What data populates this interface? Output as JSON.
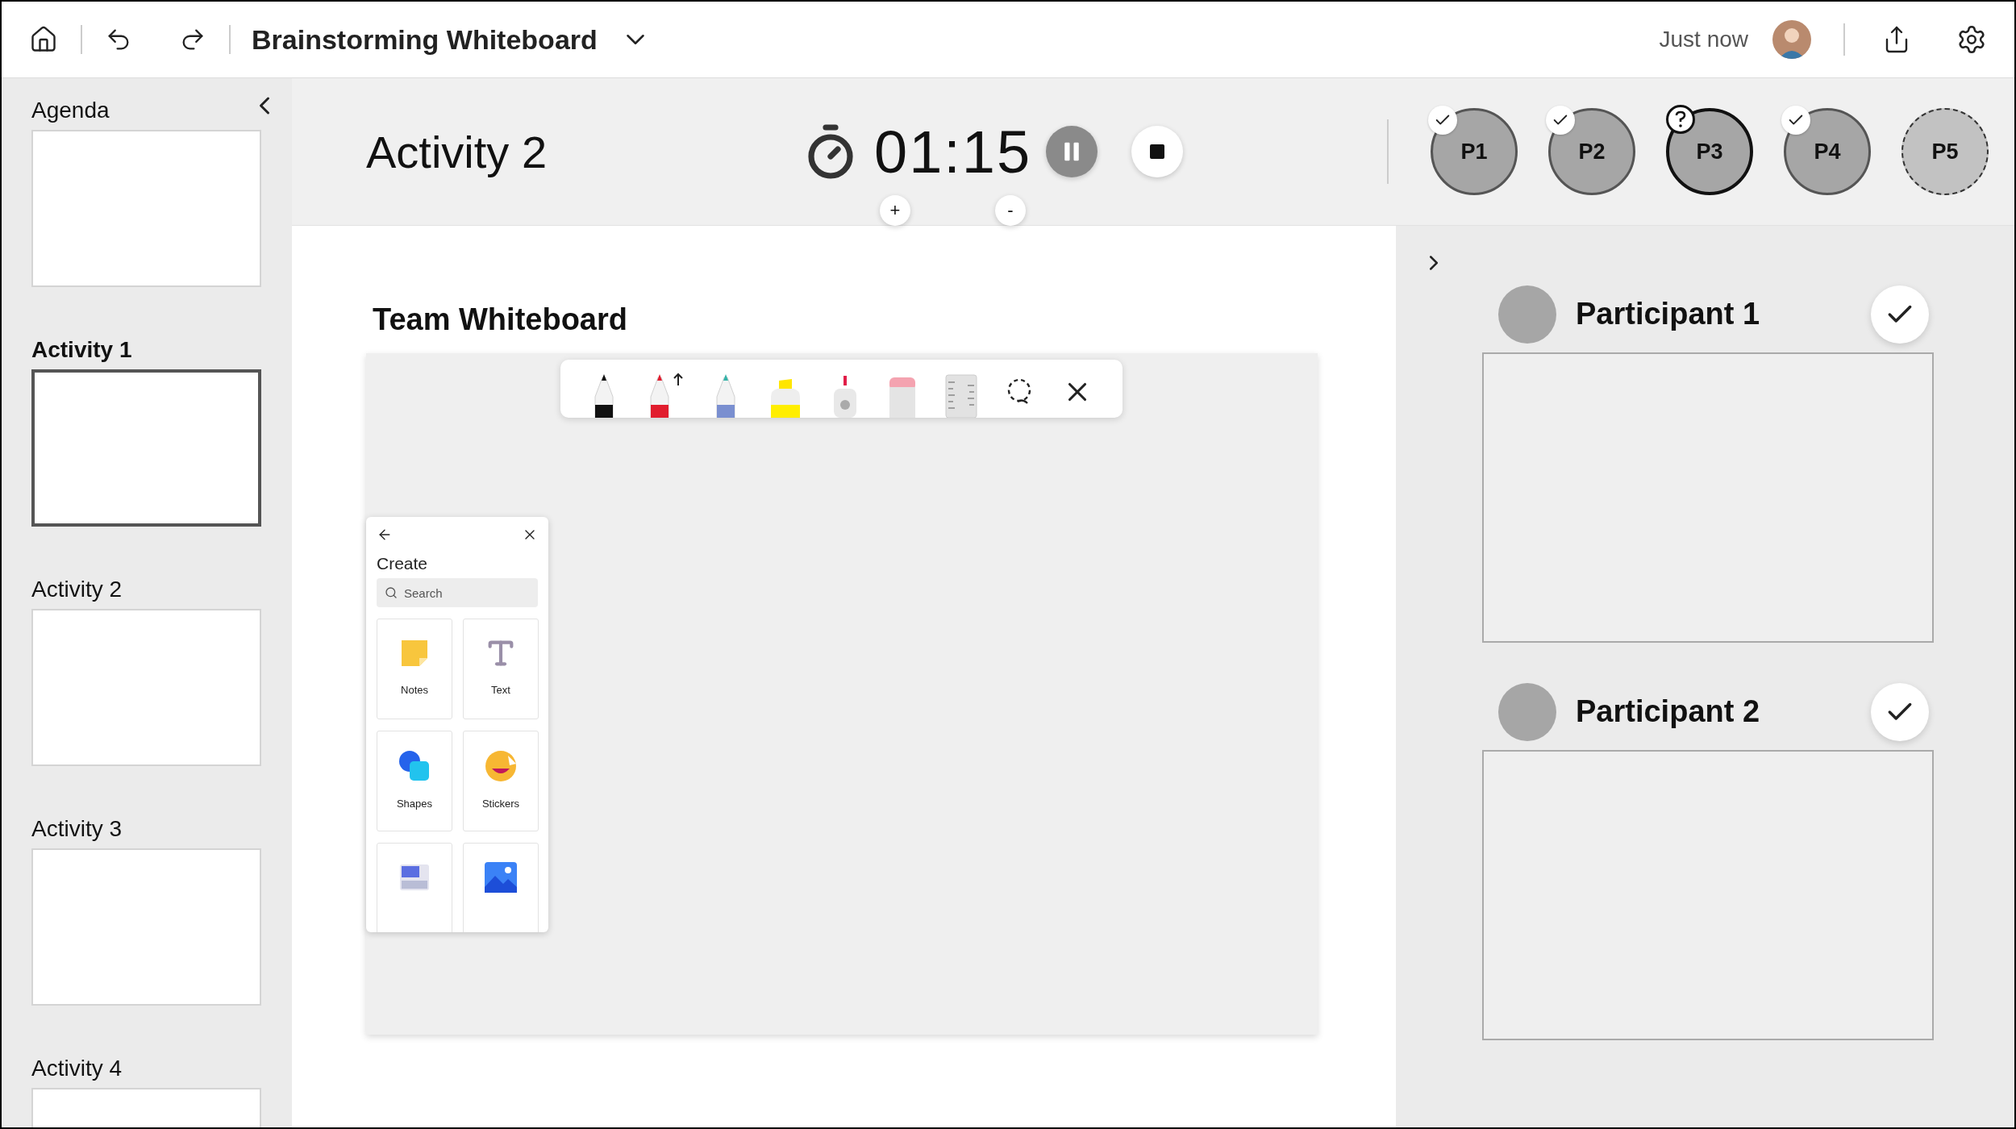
{
  "top_bar": {
    "title": "Brainstorming Whiteboard",
    "last_saved": "Just now"
  },
  "agenda": [
    {
      "label": "Agenda",
      "selected": false
    },
    {
      "label": "Activity 1",
      "selected": true
    },
    {
      "label": "Activity 2",
      "selected": false
    },
    {
      "label": "Activity 3",
      "selected": false
    },
    {
      "label": "Activity 4",
      "selected": false
    }
  ],
  "activity": {
    "title": "Activity 2",
    "timer": "01:15",
    "increase": "+",
    "decrease": "-"
  },
  "participants": [
    {
      "label": "P1",
      "checked": true,
      "question": false,
      "joined": true,
      "selected": false
    },
    {
      "label": "P2",
      "checked": true,
      "question": false,
      "joined": true,
      "selected": false
    },
    {
      "label": "P3",
      "checked": false,
      "question": true,
      "joined": true,
      "selected": true
    },
    {
      "label": "P4",
      "checked": true,
      "question": false,
      "joined": true,
      "selected": false
    },
    {
      "label": "P5",
      "checked": false,
      "question": false,
      "joined": false,
      "selected": false
    }
  ],
  "whiteboard": {
    "title": "Team Whiteboard"
  },
  "create_panel": {
    "title": "Create",
    "search_placeholder": "Search",
    "items": [
      {
        "kind": "notes",
        "label": "Notes"
      },
      {
        "kind": "text",
        "label": "Text"
      },
      {
        "kind": "shapes",
        "label": "Shapes"
      },
      {
        "kind": "stickers",
        "label": "Stickers"
      },
      {
        "kind": "templates"
      },
      {
        "kind": "images"
      }
    ]
  },
  "participant_boards": [
    {
      "name": "Participant 1",
      "checked": true
    },
    {
      "name": "Participant 2",
      "checked": true
    }
  ]
}
